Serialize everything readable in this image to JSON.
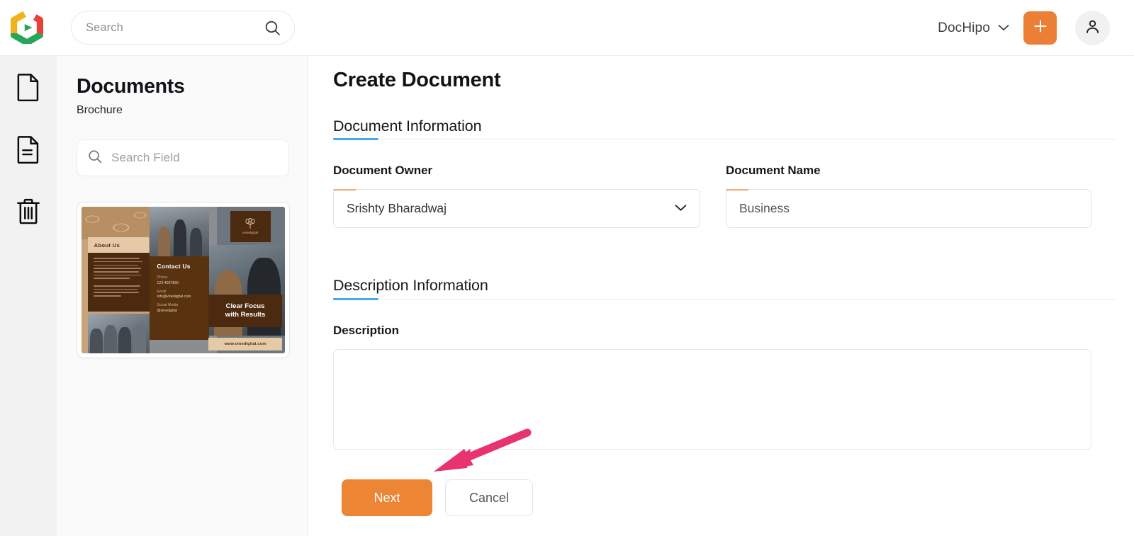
{
  "app": {
    "brand_logo": "dochipo-logo-icon",
    "accent_orange": "#ec7f36",
    "accent_blue": "#4aa8e8",
    "annotation_pink": "#e8336e"
  },
  "topbar": {
    "search": {
      "placeholder": "Search",
      "value": "",
      "icon": "search-icon"
    },
    "workspace": {
      "label": "DocHipo",
      "chevron": "chevron-down-icon"
    },
    "create_button": {
      "icon": "plus-icon",
      "label": "+"
    },
    "account_button": {
      "icon": "user-avatar-icon"
    }
  },
  "rail": {
    "items": [
      {
        "name": "documents",
        "icon": "file-blank-icon"
      },
      {
        "name": "templates",
        "icon": "file-lines-icon"
      },
      {
        "name": "trash",
        "icon": "trash-icon"
      }
    ]
  },
  "docpanel": {
    "title": "Documents",
    "subtitle": "Brochure",
    "search": {
      "placeholder": "Search Field",
      "value": "",
      "icon": "search-icon"
    },
    "thumbnail": {
      "name": "brochure-thumbnail",
      "about_heading": "About Us",
      "contact_heading": "Contact Us",
      "phone_label": "Phone",
      "phone_value": "123-4567890",
      "email_label": "Email",
      "email_value": "info@vinedigital.com",
      "social_label": "Social Media",
      "social_value": "@vinedigital",
      "tagline_line1": "Clear Focus",
      "tagline_line2": "with Results",
      "website": "www.vinedigital.com",
      "logo_text": "vinedigital"
    }
  },
  "main": {
    "page_title": "Create Document",
    "sections": [
      {
        "heading": "Document Information"
      },
      {
        "heading": "Description Information"
      }
    ],
    "fields": {
      "document_owner": {
        "label": "Document Owner",
        "value": "Srishty Bharadwaj",
        "chevron": "chevron-down-icon"
      },
      "document_name": {
        "label": "Document Name",
        "value": "Business",
        "placeholder": "Document Name"
      },
      "description": {
        "label": "Description",
        "value": "",
        "placeholder": ""
      }
    },
    "buttons": {
      "next": "Next",
      "cancel": "Cancel"
    }
  },
  "annotation": {
    "arrow": {
      "name": "highlight-arrow",
      "color": "#e8336e",
      "points_to": "next-button"
    }
  }
}
